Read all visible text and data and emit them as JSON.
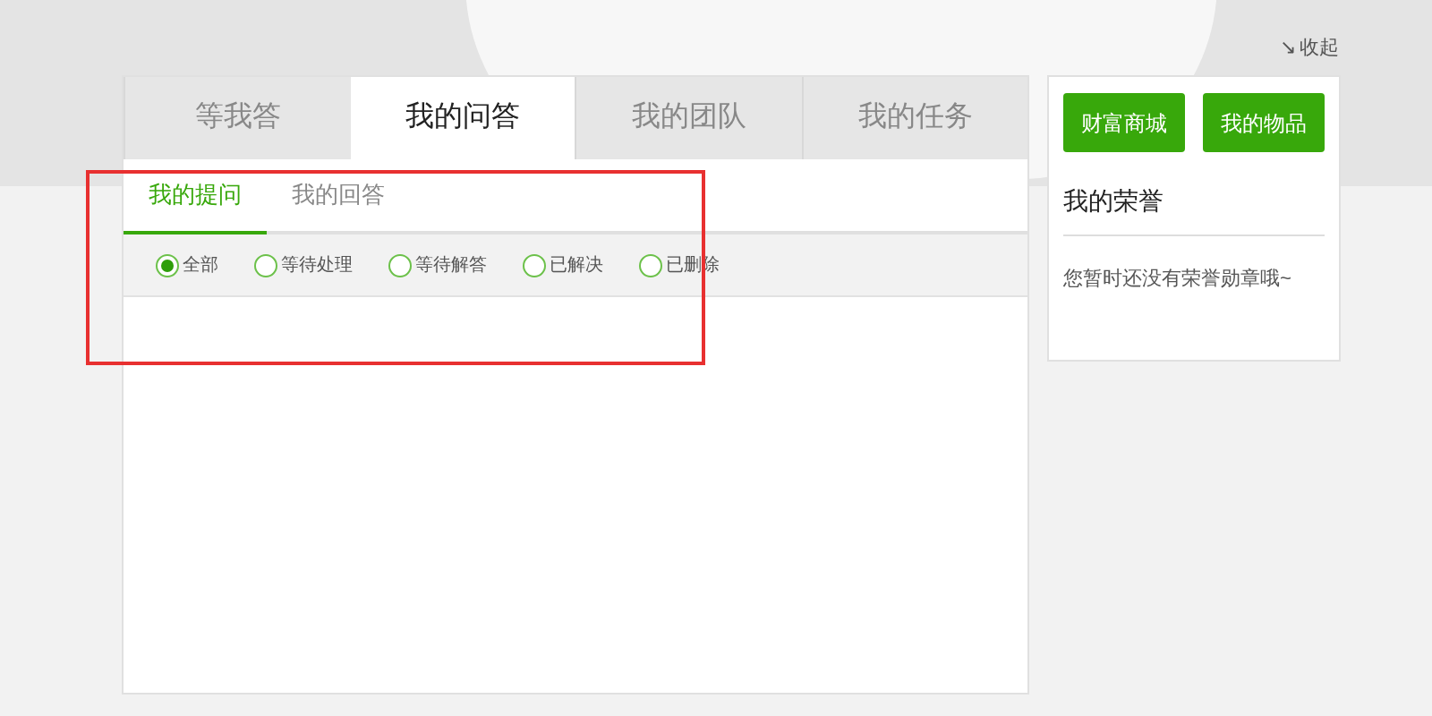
{
  "collapse_link": {
    "icon": "↘",
    "label": "收起"
  },
  "tabs": [
    {
      "label": "等我答",
      "selected": false
    },
    {
      "label": "我的问答",
      "selected": true
    },
    {
      "label": "我的团队",
      "selected": false
    },
    {
      "label": "我的任务",
      "selected": false
    }
  ],
  "sub_tabs": [
    {
      "label": "我的提问",
      "selected": true
    },
    {
      "label": "我的回答",
      "selected": false
    }
  ],
  "filters": [
    {
      "label": "全部",
      "selected": true
    },
    {
      "label": "等待处理",
      "selected": false
    },
    {
      "label": "等待解答",
      "selected": false
    },
    {
      "label": "已解决",
      "selected": false
    },
    {
      "label": "已删除",
      "selected": false
    }
  ],
  "sidebar": {
    "buttons": [
      "财富商城",
      "我的物品"
    ],
    "honor_title": "我的荣誉",
    "honor_empty": "您暂时还没有荣誉勋章哦~"
  }
}
